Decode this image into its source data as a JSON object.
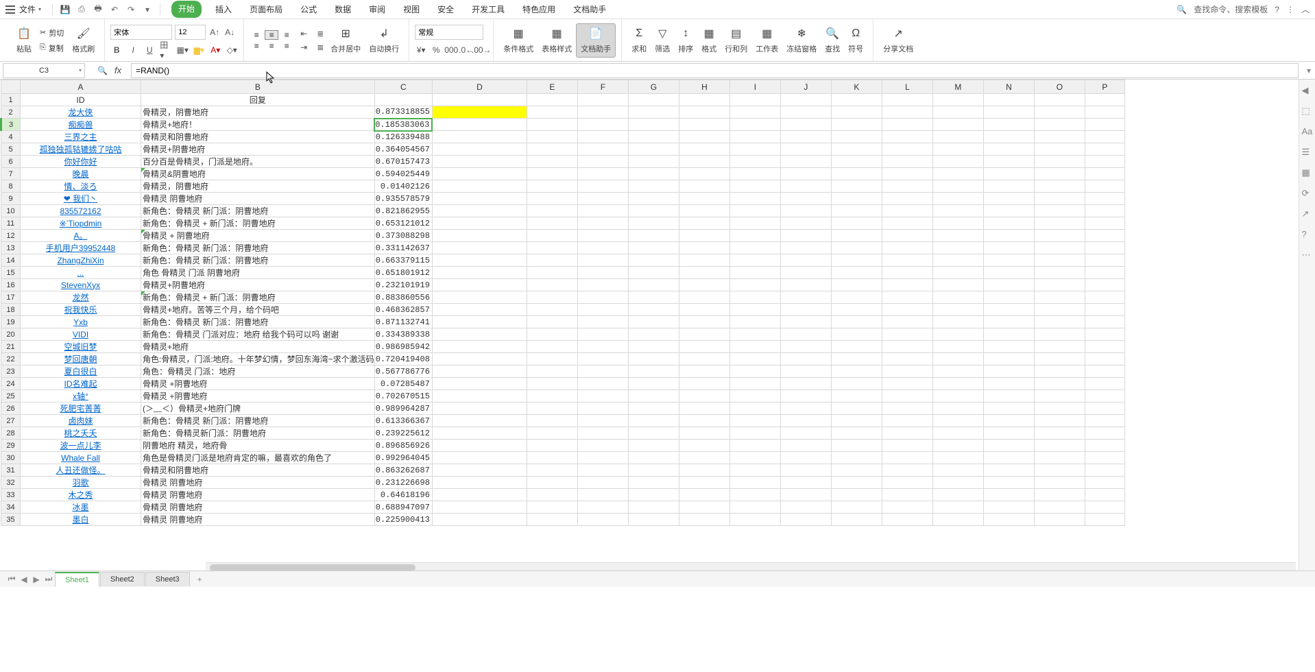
{
  "menubar": {
    "file": "文件",
    "tabs": [
      "开始",
      "插入",
      "页面布局",
      "公式",
      "数据",
      "审阅",
      "视图",
      "安全",
      "开发工具",
      "特色应用",
      "文档助手"
    ],
    "active_tab": "开始",
    "search_hint": "查找命令、搜索模板"
  },
  "ribbon": {
    "paste": "粘贴",
    "cut": "剪切",
    "copy": "复制",
    "format_painter": "格式刷",
    "font_name": "宋体",
    "font_size": "12",
    "merge_center": "合并居中",
    "wrap_text": "自动换行",
    "number_format": "常规",
    "cond_fmt": "条件格式",
    "table_style": "表格样式",
    "doc_assist": "文档助手",
    "sum": "求和",
    "filter": "筛选",
    "sort": "排序",
    "format": "格式",
    "rowcol": "行和列",
    "worksheet": "工作表",
    "freeze": "冻结窗格",
    "find": "查找",
    "symbol": "符号",
    "share": "分享文档"
  },
  "namebox": "C3",
  "formula": "=RAND()",
  "columns": [
    "A",
    "B",
    "C",
    "D",
    "E",
    "F",
    "G",
    "H",
    "I",
    "J",
    "K",
    "L",
    "M",
    "N",
    "O",
    "P"
  ],
  "headers": {
    "A": "ID",
    "B": "回复"
  },
  "rows": [
    {
      "n": 1,
      "a": "ID",
      "b": "回复",
      "c": "",
      "hdr": true
    },
    {
      "n": 2,
      "a": "龙大侠",
      "b": "骨精灵，阴曹地府",
      "c": "0.873318855",
      "d_hl": true
    },
    {
      "n": 3,
      "a": "痴痴兽",
      "b": "骨精灵+地府！",
      "c": "0.185383063",
      "active": true
    },
    {
      "n": 4,
      "a": "三界之主",
      "b": "骨精灵和阴曹地府",
      "c": "0.126339488"
    },
    {
      "n": 5,
      "a": "孤独独孤轱辘掳了咕咕",
      "b": "骨精灵+阴曹地府",
      "c": "0.364054567"
    },
    {
      "n": 6,
      "a": "你好你好",
      "b": "百分百是骨精灵，门派是地府。",
      "c": "0.670157473"
    },
    {
      "n": 7,
      "a": "晚晨",
      "b": "骨精灵&阴曹地府",
      "c": "0.594025449",
      "tri": true
    },
    {
      "n": 8,
      "a": "情、淡ろ",
      "b": "骨精灵，阴曹地府",
      "c": "0.01402126"
    },
    {
      "n": 9,
      "a": "❤  我们丶",
      "b": "骨精灵 阴曹地府",
      "c": "0.935578579"
    },
    {
      "n": 10,
      "a": "835572162",
      "b": "新角色：骨精灵 新门派：阴曹地府",
      "c": "0.821862955"
    },
    {
      "n": 11,
      "a": "※‵Tiopdmin",
      "b": "新角色：骨精灵 + 新门派：阴曹地府",
      "c": "0.653121012"
    },
    {
      "n": 12,
      "a": "A。",
      "b": "骨精灵 +  阴曹地府",
      "c": "0.373088298",
      "tri": true
    },
    {
      "n": 13,
      "a": "手机用户39952448",
      "b": "新角色：骨精灵 新门派：阴曹地府",
      "c": "0.331142637"
    },
    {
      "n": 14,
      "a": "ZhangZhiXin",
      "b": "新角色：骨精灵 新门派：阴曹地府",
      "c": "0.663379115"
    },
    {
      "n": 15,
      "a": "...",
      "b": "角色  骨精灵   门派   阴曹地府",
      "c": "0.651801912"
    },
    {
      "n": 16,
      "a": "StevenXyx",
      "b": "骨精灵+阴曹地府",
      "c": "0.232101919"
    },
    {
      "n": 17,
      "a": "龙然",
      "b": "新角色：骨精灵 + 新门派：阴曹地府",
      "c": "0.883860556",
      "tri": true
    },
    {
      "n": 18,
      "a": "祝我快乐",
      "b": "骨精灵+地府。苦等三个月，给个码吧",
      "c": "0.468362857"
    },
    {
      "n": 19,
      "a": "Yxb",
      "b": "新角色：骨精灵  新门派：阴曹地府",
      "c": "0.871132741"
    },
    {
      "n": 20,
      "a": "VIDI",
      "b": "新角色：骨精灵 门派对应：地府 给我个码可以吗 谢谢",
      "c": "0.334389338"
    },
    {
      "n": 21,
      "a": "空城旧梦",
      "b": "骨精灵+地府",
      "c": "0.986985942"
    },
    {
      "n": 22,
      "a": "梦回唐朝",
      "b": "角色:骨精灵，门派:地府。十年梦幻情，梦回东海湾~求个激活码",
      "c": "0.720419408"
    },
    {
      "n": 23,
      "a": "夏白很白",
      "b": "角色：骨精灵   门派：地府",
      "c": "0.567786776"
    },
    {
      "n": 24,
      "a": "ID名难起",
      "b": "骨精灵 +阴曹地府",
      "c": "0.07285487"
    },
    {
      "n": 25,
      "a": "x轴°",
      "b": "骨精灵 +阴曹地府",
      "c": "0.702670515"
    },
    {
      "n": 26,
      "a": "死肥宅菁菁",
      "b": "(＞﹏＜）骨精灵+地府门牌",
      "c": "0.989964287"
    },
    {
      "n": 27,
      "a": "卤肉妹",
      "b": "新角色：骨精灵 新门派：阴曹地府",
      "c": "0.613366367"
    },
    {
      "n": 28,
      "a": "桃之夭夭",
      "b": "新角色：骨精灵新门派：阴曹地府",
      "c": "0.239225612"
    },
    {
      "n": 29,
      "a": "波一点儿李",
      "b": "阴曹地府 精灵，地府骨",
      "c": "0.896856926"
    },
    {
      "n": 30,
      "a": "Whale Fall",
      "b": "角色是骨精灵门派是地府肯定的嘛，最喜欢的角色了",
      "c": "0.992964045"
    },
    {
      "n": 31,
      "a": "人丑还做怪。",
      "b": "骨精灵和阴曹地府",
      "c": "0.863262687"
    },
    {
      "n": 32,
      "a": "羽歌",
      "b": "骨精灵  阴曹地府",
      "c": "0.231226698"
    },
    {
      "n": 33,
      "a": "木之秀",
      "b": "骨精灵 阴曹地府",
      "c": "0.64618196"
    },
    {
      "n": 34,
      "a": "冰墨",
      "b": "骨精灵  阴曹地府",
      "c": "0.688947097"
    },
    {
      "n": 35,
      "a": "墨白",
      "b": "骨精灵  阴曹地府",
      "c": "0.225900413"
    }
  ],
  "sheet_tabs": [
    "Sheet1",
    "Sheet2",
    "Sheet3"
  ],
  "active_sheet": "Sheet1"
}
